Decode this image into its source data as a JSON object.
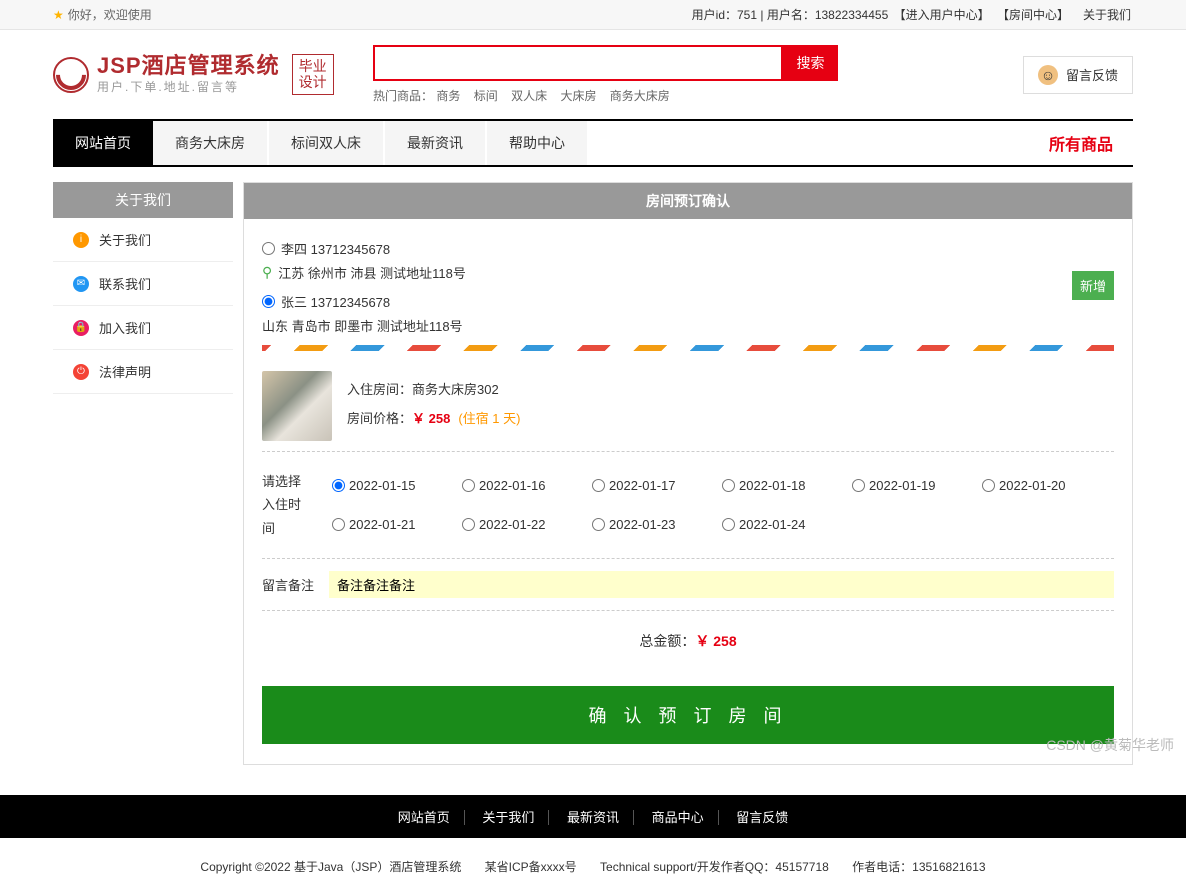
{
  "topbar": {
    "welcome": "你好，欢迎使用",
    "user_id_label": "用户id：751",
    "username_label": "用户名：13822334455",
    "user_center": "【进入用户中心】",
    "room_center": "【房间中心】",
    "about": "关于我们"
  },
  "logo": {
    "title": "JSP酒店管理系统",
    "subtitle": "用户.下单.地址.留言等",
    "badge_line1": "毕业",
    "badge_line2": "设计"
  },
  "search": {
    "button": "搜索",
    "hot_label": "热门商品：",
    "hot_items": [
      "商务",
      "标间",
      "双人床",
      "大床房",
      "商务大床房"
    ]
  },
  "feedback": {
    "label": "留言反馈"
  },
  "nav": {
    "items": [
      "网站首页",
      "商务大床房",
      "标间双人床",
      "最新资讯",
      "帮助中心"
    ],
    "right": "所有商品"
  },
  "sidebar": {
    "header": "关于我们",
    "items": [
      {
        "label": "关于我们",
        "icon": "info",
        "color": "ic-orange"
      },
      {
        "label": "联系我们",
        "icon": "mail",
        "color": "ic-blue"
      },
      {
        "label": "加入我们",
        "icon": "lock",
        "color": "ic-pink"
      },
      {
        "label": "法律声明",
        "icon": "power",
        "color": "ic-red"
      }
    ]
  },
  "content": {
    "header": "房间预订确认",
    "addresses": [
      {
        "name": "李四 13712345678",
        "detail": "江苏 徐州市 沛县 测试地址118号",
        "selected": false
      },
      {
        "name": "张三 13712345678",
        "detail": "山东 青岛市 即墨市 测试地址118号",
        "selected": true
      }
    ],
    "add_button": "新增",
    "room": {
      "label1": "入住房间：",
      "value1": "商务大床房302",
      "label2": "房间价格：",
      "price": "￥ 258",
      "nights": "(住宿 1 天)"
    },
    "date": {
      "label1": "请选择",
      "label2": "入住时间",
      "options": [
        "2022-01-15",
        "2022-01-16",
        "2022-01-17",
        "2022-01-18",
        "2022-01-19",
        "2022-01-20",
        "2022-01-21",
        "2022-01-22",
        "2022-01-23",
        "2022-01-24"
      ],
      "selected": "2022-01-15"
    },
    "remark": {
      "label": "留言备注",
      "value": "备注备注备注"
    },
    "total": {
      "label": "总金额：",
      "value": "￥ 258"
    },
    "confirm": "确 认 预 订 房 间"
  },
  "footer": {
    "nav": [
      "网站首页",
      "关于我们",
      "最新资讯",
      "商品中心",
      "留言反馈"
    ],
    "copyright": "Copyright ©2022 基于Java（JSP）酒店管理系统",
    "icp": "某省ICP备xxxx号",
    "tech": "Technical support/开发作者QQ：45157718",
    "phone": "作者电话：13516821613"
  },
  "watermark": "CSDN @黄菊华老师"
}
